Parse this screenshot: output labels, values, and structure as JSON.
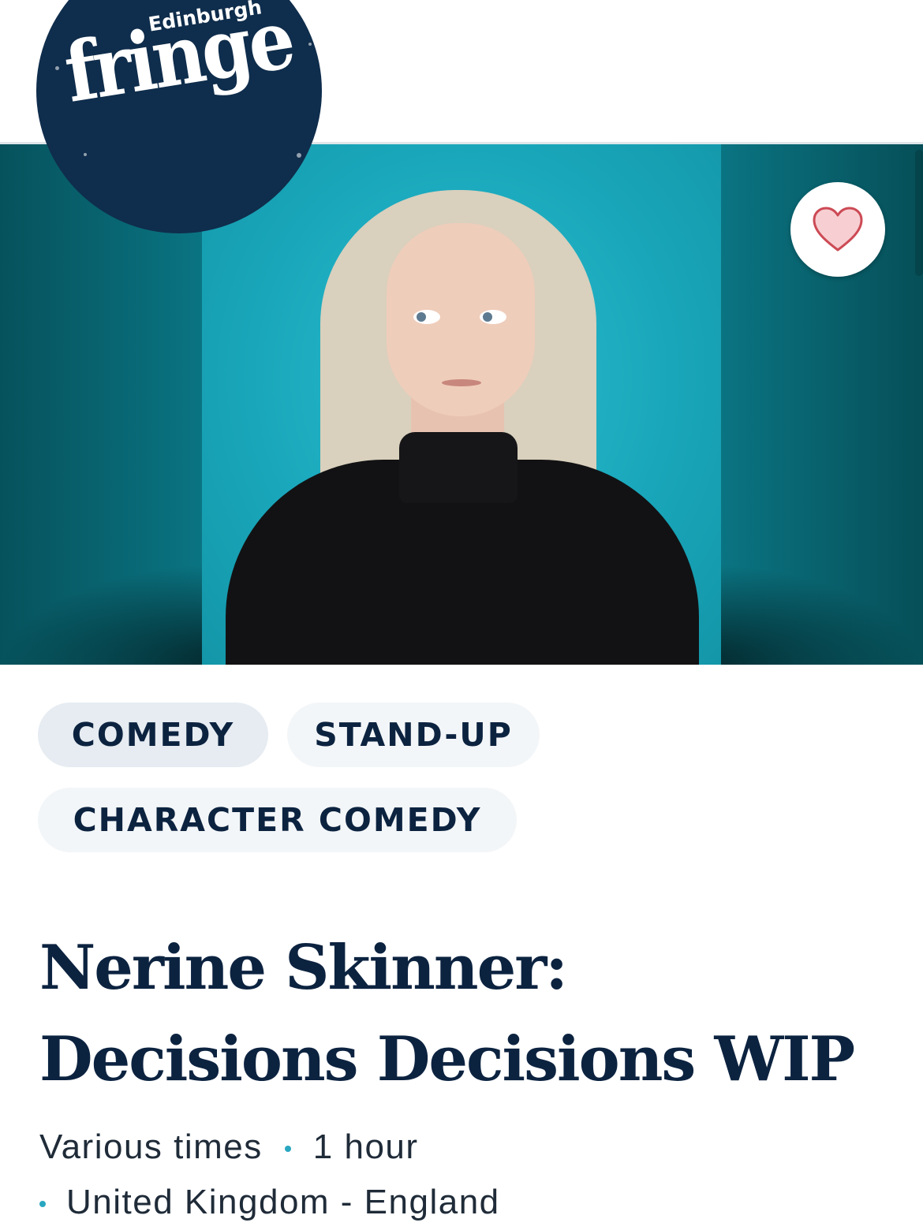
{
  "brand": {
    "city": "Edinburgh",
    "name": "fringe",
    "color": "#0f2d4c"
  },
  "header": {
    "icons": [
      "ticket-icon",
      "cart-icon",
      "account-icon",
      "menu-icon"
    ]
  },
  "hero": {
    "favourite_icon": "heart-icon",
    "accent_color": "#1aa7bb"
  },
  "tags": [
    "COMEDY",
    "STAND-UP",
    "CHARACTER COMEDY"
  ],
  "show": {
    "title_line1": "Nerine Skinner:",
    "title_line2": "Decisions Decisions WIP",
    "times": "Various times",
    "duration": "1 hour",
    "country": "United Kingdom - England"
  }
}
